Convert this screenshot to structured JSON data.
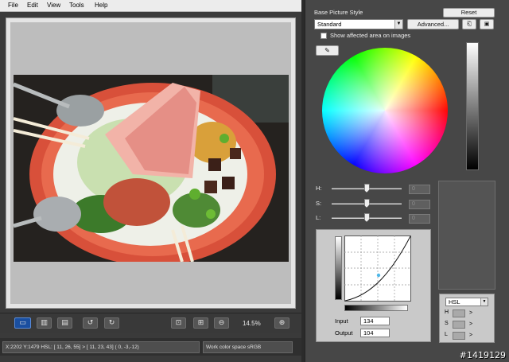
{
  "menubar": {
    "items": [
      "File",
      "Edit",
      "View",
      "Tools",
      "Help"
    ]
  },
  "toolbar": {
    "zoom": "14.5%",
    "view_buttons": [
      "single-view",
      "compare-view",
      "fullscreen-view",
      "rotate-left",
      "rotate-right",
      "fit-window",
      "actual-size",
      "zoom-out",
      "zoom-in"
    ]
  },
  "statusbar": {
    "coords": "X:2202 Y:1479  HSL: [ 11, 26, 55] > [ 11, 23, 43]  (  0, -3,-12)",
    "color_space": "Work color space  sRGB"
  },
  "panel": {
    "title": "Base Picture Style",
    "reset_label": "Reset",
    "style_select": "Standard",
    "advanced_label": "Advanced...",
    "show_affected_label": "Show affected area on images",
    "show_affected_checked": false,
    "sliders": [
      {
        "label": "H:",
        "value": "0",
        "level": 0.5
      },
      {
        "label": "S:",
        "value": "0",
        "level": 0.5
      },
      {
        "label": "L:",
        "value": "0",
        "level": 0.5
      }
    ],
    "curve": {
      "input_label": "Input",
      "input_value": "134",
      "output_label": "Output",
      "output_value": "104"
    },
    "hsl": {
      "mode": "HSL",
      "rows": [
        {
          "label": "H",
          "arrow": ">"
        },
        {
          "label": "S",
          "arrow": ">"
        },
        {
          "label": "L",
          "arrow": ">"
        }
      ]
    }
  },
  "watermark": "#1419129",
  "colors": {
    "accent": "#1a4fa0",
    "panel": "#474747",
    "menubar": "#ececec"
  }
}
